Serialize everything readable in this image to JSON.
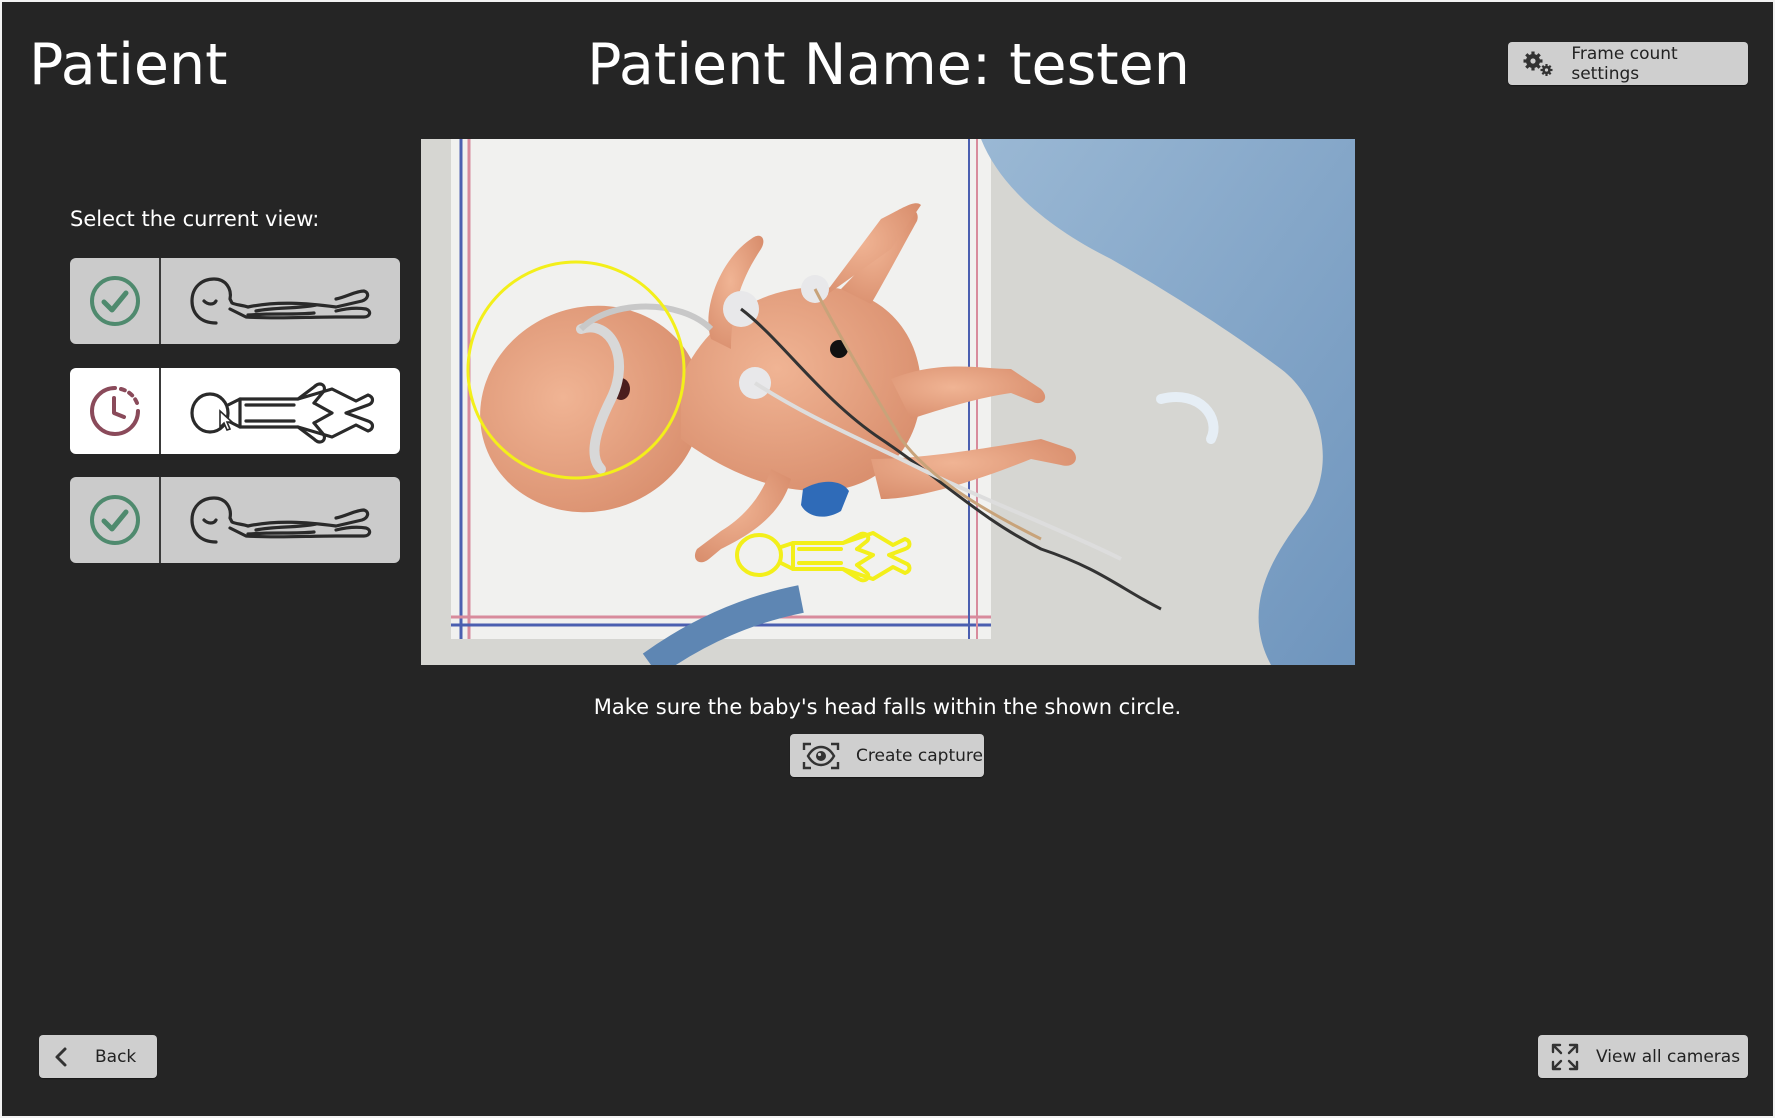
{
  "header": {
    "app_title": "Patient",
    "patient_name": "Patient Name: testen",
    "frame_settings_label": "Frame count settings"
  },
  "view_select": {
    "label": "Select the current view:",
    "views": [
      {
        "status": "done",
        "status_icon": "check-circle-icon",
        "pose_icon": "side-lying-pose-icon"
      },
      {
        "status": "pending",
        "status_icon": "clock-icon",
        "pose_icon": "supine-pose-icon",
        "active": true
      },
      {
        "status": "done",
        "status_icon": "check-circle-icon",
        "pose_icon": "side-lying-pose-icon"
      }
    ]
  },
  "camera": {
    "overlay_color": "#f3ef1a",
    "overlay_icons": [
      "head-target-circle",
      "supine-pose-outline"
    ]
  },
  "instruction": "Make sure the baby's head falls within the shown circle.",
  "capture_label": "Create capture",
  "footer": {
    "back_label": "Back",
    "view_all_label": "View all cameras"
  },
  "colors": {
    "background": "#252525",
    "button": "#cfcfcf",
    "check": "#4f8a6e",
    "clock": "#8a4a5a"
  }
}
